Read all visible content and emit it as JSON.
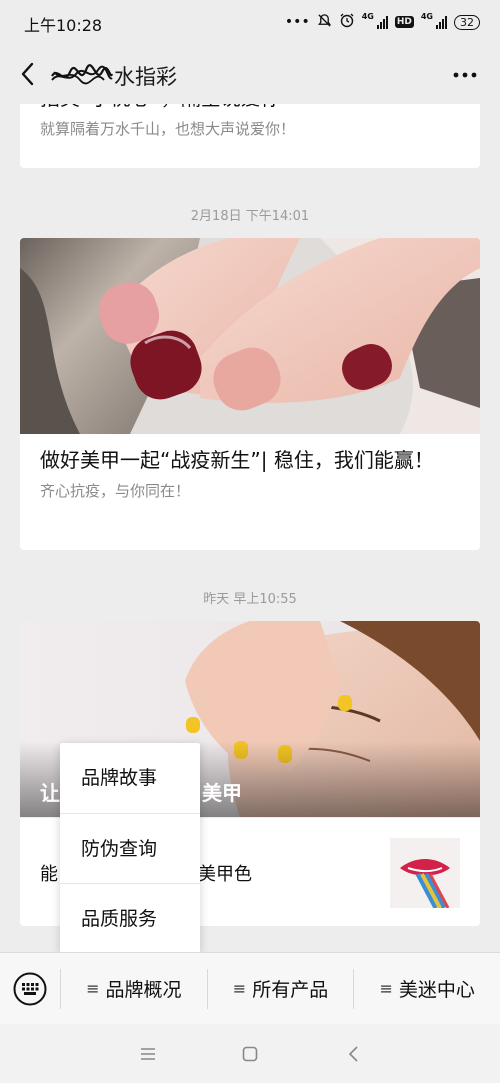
{
  "status": {
    "time": "上午10:28",
    "network_a": "4G",
    "network_b": "4G",
    "hd": "HD",
    "battery": "32"
  },
  "nav": {
    "title_visible": "水指彩"
  },
  "articles": [
    {
      "title": "指尖“小桃心”，隔空说爱你",
      "subtitle": "就算隔着万水千山，也想大声说爱你！"
    },
    {
      "timestamp": "2月18日 下午14:01",
      "title": "做好美甲一起“战疫新生”| 稳住，我们能赢！",
      "subtitle": "齐心抗疫，与你同在！"
    },
    {
      "timestamp": "昨天 早上10:55",
      "overlay_title": "让美甲",
      "overlay_title_tail": "美甲",
      "item_text_head": "能",
      "item_text_tail": "美甲色"
    }
  ],
  "popup_menu": {
    "items": [
      "品牌故事",
      "防伪查询",
      "品质服务"
    ]
  },
  "bottom_menu": {
    "tabs": [
      "品牌概况",
      "所有产品",
      "美迷中心"
    ]
  },
  "icons": {
    "back": "chevron-left-icon",
    "more": "more-dots-icon",
    "keyboard": "keyboard-icon"
  }
}
